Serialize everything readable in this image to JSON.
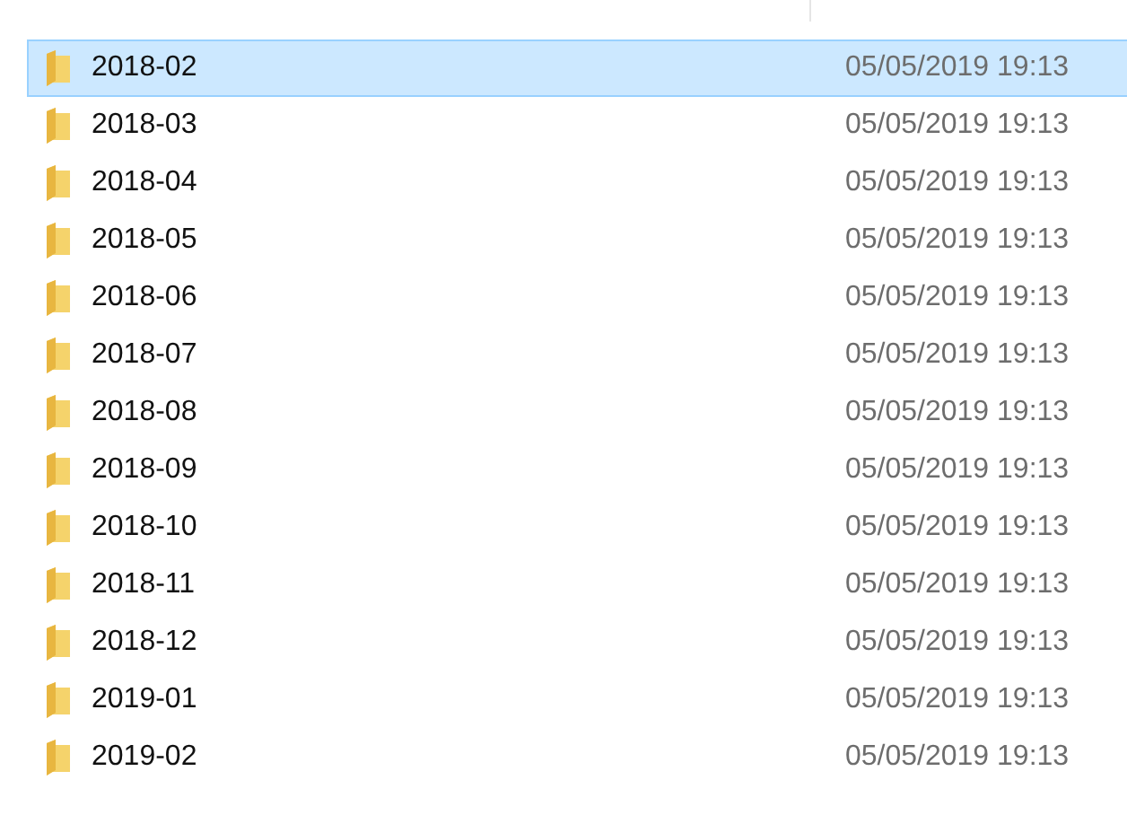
{
  "rows": [
    {
      "name": "2018-02",
      "modified": "05/05/2019 19:13",
      "selected": true
    },
    {
      "name": "2018-03",
      "modified": "05/05/2019 19:13",
      "selected": false
    },
    {
      "name": "2018-04",
      "modified": "05/05/2019 19:13",
      "selected": false
    },
    {
      "name": "2018-05",
      "modified": "05/05/2019 19:13",
      "selected": false
    },
    {
      "name": "2018-06",
      "modified": "05/05/2019 19:13",
      "selected": false
    },
    {
      "name": "2018-07",
      "modified": "05/05/2019 19:13",
      "selected": false
    },
    {
      "name": "2018-08",
      "modified": "05/05/2019 19:13",
      "selected": false
    },
    {
      "name": "2018-09",
      "modified": "05/05/2019 19:13",
      "selected": false
    },
    {
      "name": "2018-10",
      "modified": "05/05/2019 19:13",
      "selected": false
    },
    {
      "name": "2018-11",
      "modified": "05/05/2019 19:13",
      "selected": false
    },
    {
      "name": "2018-12",
      "modified": "05/05/2019 19:13",
      "selected": false
    },
    {
      "name": "2019-01",
      "modified": "05/05/2019 19:13",
      "selected": false
    },
    {
      "name": "2019-02",
      "modified": "05/05/2019 19:13",
      "selected": false
    }
  ]
}
